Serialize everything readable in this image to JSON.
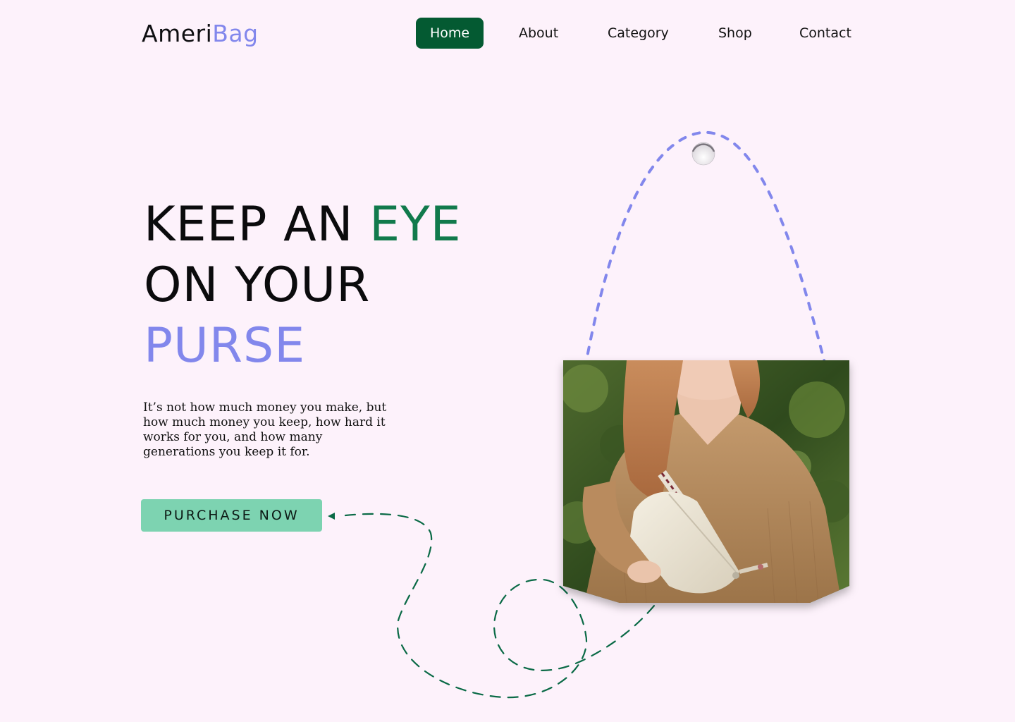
{
  "brand": {
    "logo_part1": "Ameri",
    "logo_part2": "Bag"
  },
  "nav": {
    "items": [
      {
        "label": "Home",
        "active": true
      },
      {
        "label": "About",
        "active": false
      },
      {
        "label": "Category",
        "active": false
      },
      {
        "label": "Shop",
        "active": false
      },
      {
        "label": "Contact",
        "active": false
      }
    ]
  },
  "hero": {
    "headline_line1_a": "KEEP AN",
    "headline_line1_b": "EYE",
    "headline_line2": "ON YOUR",
    "headline_line3": "PURSE",
    "description": "It’s not how much money you make, but how much money you keep, how hard it works for you, and how many generations you keep it for.",
    "cta_label": "PURCHASE NOW",
    "image_icon": "woman-with-belt-bag-photo"
  },
  "colors": {
    "background": "#fdf2fb",
    "brand_purple": "#8287ec",
    "brand_green": "#117a4c",
    "nav_active": "#045a32",
    "cta": "#7dd3b1"
  }
}
